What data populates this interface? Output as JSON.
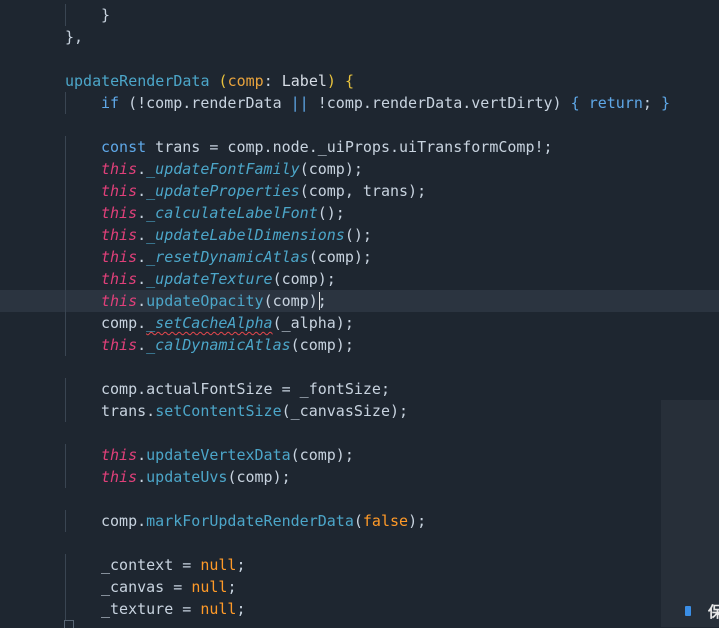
{
  "editor": {
    "lines": [
      {
        "indent": 2,
        "tokens": [
          [
            "p",
            "}"
          ]
        ]
      },
      {
        "indent": 1,
        "tokens": [
          [
            "p",
            "},"
          ]
        ]
      },
      {
        "indent": 0,
        "tokens": []
      },
      {
        "indent": 1,
        "tokens": [
          [
            "fn",
            "updateRenderData"
          ],
          [
            "p",
            " "
          ],
          [
            "br",
            "("
          ],
          [
            "pm",
            "comp"
          ],
          [
            "p",
            ": "
          ],
          [
            "ty",
            "Label"
          ],
          [
            "br",
            ")"
          ],
          [
            "p",
            " "
          ],
          [
            "br",
            "{"
          ]
        ]
      },
      {
        "indent": 2,
        "tokens": [
          [
            "k",
            "if"
          ],
          [
            "p",
            " ("
          ],
          [
            "p",
            "!comp.renderData "
          ],
          [
            "k",
            "||"
          ],
          [
            "p",
            " !comp.renderData.vertDirty) "
          ],
          [
            "k",
            "{"
          ],
          [
            "p",
            " "
          ],
          [
            "k",
            "return"
          ],
          [
            "p",
            "; "
          ],
          [
            "k",
            "}"
          ]
        ]
      },
      {
        "indent": 0,
        "tokens": []
      },
      {
        "indent": 2,
        "tokens": [
          [
            "k",
            "const"
          ],
          [
            "p",
            " trans = comp.node._uiProps.uiTransformComp!;"
          ]
        ]
      },
      {
        "indent": 2,
        "tokens": [
          [
            "th",
            "this"
          ],
          [
            "p",
            "."
          ],
          [
            "m",
            "_updateFontFamily"
          ],
          [
            "p",
            "(comp);"
          ]
        ]
      },
      {
        "indent": 2,
        "tokens": [
          [
            "th",
            "this"
          ],
          [
            "p",
            "."
          ],
          [
            "m",
            "_updateProperties"
          ],
          [
            "p",
            "(comp, trans);"
          ]
        ]
      },
      {
        "indent": 2,
        "tokens": [
          [
            "th",
            "this"
          ],
          [
            "p",
            "."
          ],
          [
            "m",
            "_calculateLabelFont"
          ],
          [
            "p",
            "();"
          ]
        ]
      },
      {
        "indent": 2,
        "tokens": [
          [
            "th",
            "this"
          ],
          [
            "p",
            "."
          ],
          [
            "m",
            "_updateLabelDimensions"
          ],
          [
            "p",
            "();"
          ]
        ]
      },
      {
        "indent": 2,
        "tokens": [
          [
            "th",
            "this"
          ],
          [
            "p",
            "."
          ],
          [
            "m",
            "_resetDynamicAtlas"
          ],
          [
            "p",
            "(comp);"
          ]
        ]
      },
      {
        "indent": 2,
        "tokens": [
          [
            "th",
            "this"
          ],
          [
            "p",
            "."
          ],
          [
            "m",
            "_updateTexture"
          ],
          [
            "p",
            "(comp);"
          ]
        ]
      },
      {
        "indent": 2,
        "current": true,
        "tokens": [
          [
            "th",
            "this"
          ],
          [
            "p",
            "."
          ],
          [
            "fn",
            "updateOpacity"
          ],
          [
            "p",
            "(comp);"
          ]
        ]
      },
      {
        "indent": 2,
        "tokens": [
          [
            "p",
            "comp."
          ],
          [
            "m",
            "_setCacheAlpha",
            "squig"
          ],
          [
            "p",
            "(_alpha);"
          ]
        ]
      },
      {
        "indent": 2,
        "tokens": [
          [
            "th",
            "this"
          ],
          [
            "p",
            "."
          ],
          [
            "m",
            "_calDynamicAtlas"
          ],
          [
            "p",
            "(comp);"
          ]
        ]
      },
      {
        "indent": 0,
        "tokens": []
      },
      {
        "indent": 2,
        "tokens": [
          [
            "p",
            "comp.actualFontSize = _fontSize;"
          ]
        ]
      },
      {
        "indent": 2,
        "tokens": [
          [
            "p",
            "trans."
          ],
          [
            "fn",
            "setContentSize"
          ],
          [
            "p",
            "(_canvasSize);"
          ]
        ]
      },
      {
        "indent": 0,
        "tokens": []
      },
      {
        "indent": 2,
        "tokens": [
          [
            "th",
            "this"
          ],
          [
            "p",
            "."
          ],
          [
            "fn",
            "updateVertexData"
          ],
          [
            "p",
            "(comp);"
          ]
        ]
      },
      {
        "indent": 2,
        "tokens": [
          [
            "th",
            "this"
          ],
          [
            "p",
            "."
          ],
          [
            "fn",
            "updateUvs"
          ],
          [
            "p",
            "(comp);"
          ]
        ]
      },
      {
        "indent": 0,
        "tokens": []
      },
      {
        "indent": 2,
        "tokens": [
          [
            "p",
            "comp."
          ],
          [
            "fn",
            "markForUpdateRenderData"
          ],
          [
            "p",
            "("
          ],
          [
            "lit",
            "false"
          ],
          [
            "p",
            ");"
          ]
        ]
      },
      {
        "indent": 0,
        "tokens": []
      },
      {
        "indent": 2,
        "tokens": [
          [
            "p",
            "_context = "
          ],
          [
            "lit",
            "null"
          ],
          [
            "p",
            ";"
          ]
        ]
      },
      {
        "indent": 2,
        "tokens": [
          [
            "p",
            "_canvas = "
          ],
          [
            "lit",
            "null"
          ],
          [
            "p",
            ";"
          ]
        ]
      },
      {
        "indent": 2,
        "tokens": [
          [
            "p",
            "_texture = "
          ],
          [
            "lit",
            "null"
          ],
          [
            "p",
            ";"
          ]
        ]
      }
    ]
  },
  "badge": {
    "icon": "app-logo-icon",
    "text": "保"
  }
}
